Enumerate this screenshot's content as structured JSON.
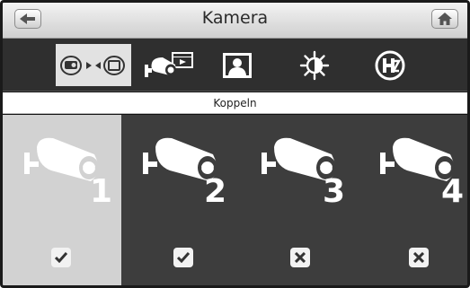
{
  "header": {
    "title": "Kamera",
    "back_icon": "back-arrow-icon",
    "home_icon": "home-icon"
  },
  "toolbar": {
    "items": [
      {
        "icon": "camera-pair-icon",
        "active": true
      },
      {
        "icon": "camera-record-icon",
        "active": false
      },
      {
        "icon": "person-photo-icon",
        "active": false
      },
      {
        "icon": "brightness-icon",
        "active": false
      },
      {
        "icon": "hz-icon",
        "active": false
      }
    ]
  },
  "subbar": {
    "label": "Koppeln"
  },
  "cameras": [
    {
      "number": "1",
      "status": "checked",
      "selected": true
    },
    {
      "number": "2",
      "status": "checked",
      "selected": false
    },
    {
      "number": "3",
      "status": "unpaired",
      "selected": false
    },
    {
      "number": "4",
      "status": "unpaired",
      "selected": false
    }
  ],
  "colors": {
    "active_bg": "#d2d2d2",
    "grid_bg": "#3d3d3d",
    "toolbar_bg": "#2f2f2f"
  }
}
